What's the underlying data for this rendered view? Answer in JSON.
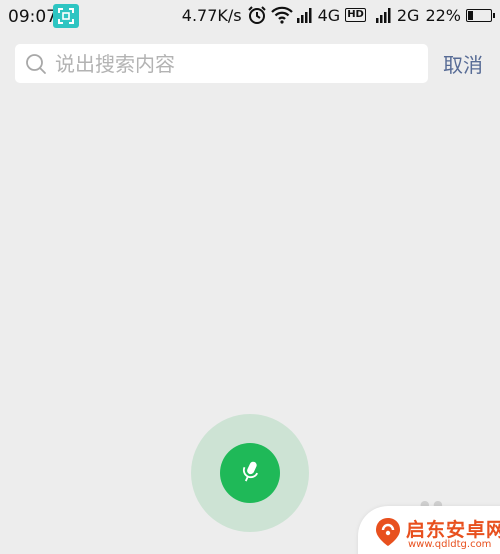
{
  "status_bar": {
    "time": "09:07",
    "network_speed": "4.77K/s",
    "net_4g": "4G",
    "hd": "HD",
    "net_2g": "2G",
    "battery_percent": "22%",
    "battery_level": 0.22
  },
  "search": {
    "placeholder": "说出搜索内容",
    "value": ""
  },
  "actions": {
    "cancel_label": "取消"
  },
  "watermark": {
    "name": "启东安卓网",
    "url": "www.qdldtg.com"
  },
  "colors": {
    "background": "#ededed",
    "accent_green": "#1fb958",
    "halo_green": "#cde3d4",
    "cancel_blue": "#576b95",
    "scan_badge": "#2ec5c2",
    "watermark_orange": "#e8501e"
  },
  "icons": [
    "scan-icon",
    "alarm-icon",
    "wifi-icon",
    "signal-icon",
    "battery-icon",
    "search-icon",
    "microphone-icon",
    "watermark-logo-icon"
  ]
}
